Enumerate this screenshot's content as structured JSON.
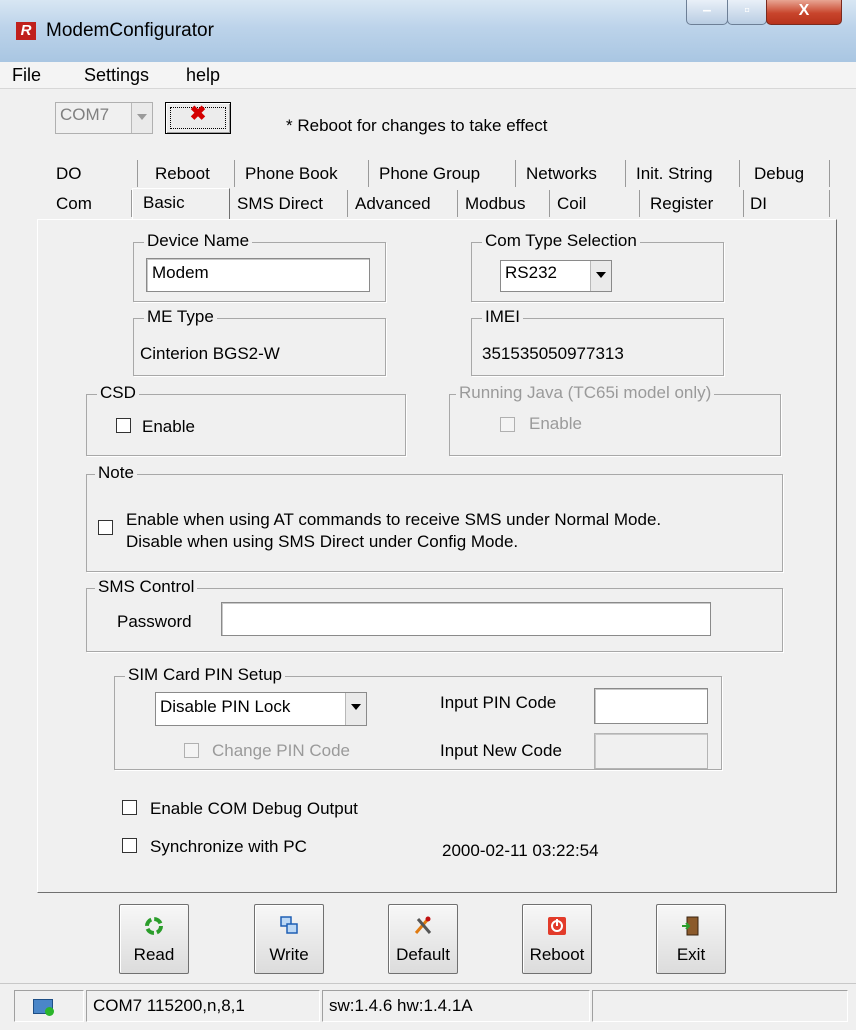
{
  "window": {
    "title": "ModemConfigurator"
  },
  "menu": [
    "File",
    "Settings",
    "help"
  ],
  "toolbar": {
    "port": "COM7",
    "reboot_note": "* Reboot for changes to take effect"
  },
  "tabs_back": [
    "DO",
    "Reboot",
    "Phone Book",
    "Phone Group",
    "Networks",
    "Init. String",
    "Debug"
  ],
  "tabs_front": [
    "Com",
    "Basic",
    "SMS Direct",
    "Advanced",
    "Modbus",
    "Coil",
    "Register",
    "DI"
  ],
  "active_tab": "Basic",
  "device_name": {
    "label": "Device Name",
    "value": "Modem"
  },
  "com_type": {
    "label": "Com Type Selection",
    "value": "RS232"
  },
  "me_type": {
    "label": "ME Type",
    "value": "Cinterion BGS2-W"
  },
  "imei": {
    "label": "IMEI",
    "value": "351535050977313"
  },
  "csd": {
    "label": "CSD",
    "enable": "Enable"
  },
  "java": {
    "label": "Running Java (TC65i model only)",
    "enable": "Enable"
  },
  "note": {
    "label": "Note",
    "line1": "Enable when using AT commands to receive SMS under Normal Mode.",
    "line2": "Disable when using SMS Direct under Config Mode."
  },
  "sms_control": {
    "label": "SMS Control",
    "password_label": "Password",
    "password_value": ""
  },
  "sim": {
    "label": "SIM Card PIN Setup",
    "pin_lock": "Disable PIN Lock",
    "change_pin": "Change PIN Code",
    "input_pin": "Input PIN Code",
    "input_new": "Input New Code"
  },
  "options": {
    "debug_output": "Enable COM Debug Output",
    "sync_pc": "Synchronize with PC",
    "datetime": "2000-02-11 03:22:54"
  },
  "buttons": {
    "read": "Read",
    "write": "Write",
    "default": "Default",
    "reboot": "Reboot",
    "exit": "Exit"
  },
  "status": {
    "port_info": "COM7 115200,n,8,1",
    "version": "sw:1.4.6 hw:1.4.1A"
  },
  "colors": {
    "accent_red": "#d40000",
    "title_bar": "#bcd3ea"
  }
}
